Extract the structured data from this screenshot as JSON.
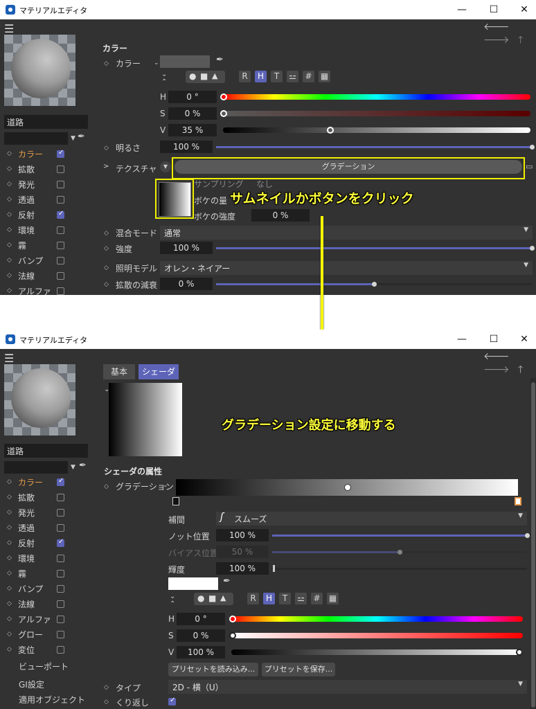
{
  "window_title": "マテリアルエディタ",
  "win_controls": {
    "minimize": "—",
    "maximize": "☐",
    "close": "✕"
  },
  "nav": {
    "back": "🡐",
    "forward": "🡒",
    "up": "🡑"
  },
  "material_name": "道路",
  "channels": [
    {
      "label": "カラー",
      "checked": true,
      "active": true
    },
    {
      "label": "拡散",
      "checked": false
    },
    {
      "label": "発光",
      "checked": false
    },
    {
      "label": "透過",
      "checked": false
    },
    {
      "label": "反射",
      "checked": true
    },
    {
      "label": "環境",
      "checked": false
    },
    {
      "label": "霧",
      "checked": false
    },
    {
      "label": "バンプ",
      "checked": false
    },
    {
      "label": "法線",
      "checked": false
    },
    {
      "label": "アルファ",
      "checked": false
    },
    {
      "label": "グロー",
      "checked": false
    },
    {
      "label": "変位",
      "checked": false
    }
  ],
  "sidebar_extra": [
    "ビューポート",
    "GI設定",
    "適用オブジェクト"
  ],
  "top": {
    "section": "カラー",
    "color_label": "カラー",
    "mode_buttons": [
      "R",
      "H",
      "T",
      "⚍",
      "#",
      "▦"
    ],
    "h_label": "H",
    "h_value": "0 °",
    "s_label": "S",
    "s_value": "0 %",
    "v_label": "V",
    "v_value": "35 %",
    "v_level": 0.35,
    "brightness_label": "明るさ",
    "brightness_value": "100 %",
    "brightness_level": 1.0,
    "texture_label": "テクスチャ",
    "texture_button": "グラデーション",
    "filter_label": "サンプリング",
    "filter_value": "なし",
    "blur_amount_label": "ボケの量",
    "blur_strength_label": "ボケの強度",
    "blur_strength_value": "0 %",
    "blend_mode_label": "混合モード",
    "blend_mode_value": "通常",
    "strength_label": "強度",
    "strength_value": "100 %",
    "strength_level": 1.0,
    "lighting_label": "照明モデル",
    "lighting_value": "オレン・ネイアー",
    "diffuse_falloff_label": "拡散の減衰",
    "diffuse_falloff_value": "0 %",
    "diffuse_falloff_level": 0.5
  },
  "bottom": {
    "tabs": [
      "基本",
      "シェーダ"
    ],
    "shader_props_title": "シェーダの属性",
    "gradient_label": "グラデーション",
    "interp_label": "補間",
    "interp_value": "スムーズ",
    "knot_pos_label": "ノット位置",
    "knot_pos_value": "100 %",
    "knot_pos_level": 1.0,
    "bias_pos_label": "バイアス位置",
    "bias_pos_value": "50 %",
    "bias_pos_level": 0.5,
    "brightness_label": "輝度",
    "brightness_value": "100 %",
    "brightness_level": 0.0,
    "mode_buttons": [
      "R",
      "H",
      "T",
      "⚍",
      "#",
      "▦"
    ],
    "h_label": "H",
    "h_value": "0 °",
    "s_label": "S",
    "s_value": "0 %",
    "v_label": "V",
    "v_value": "100 %",
    "load_preset": "プリセットを読み込み...",
    "save_preset": "プリセットを保存...",
    "type_label": "タイプ",
    "type_value": "2D - 横（U）",
    "repeat_label": "くり返し",
    "repeat_checked": true
  },
  "annotations": {
    "click_hint": "サムネイルかボタンをクリック",
    "move_hint": "グラデーション設定に移動する"
  },
  "colors": {
    "accent": "#5d64b8",
    "active_channel": "#e89c4b",
    "annotation": "#ffff3a",
    "bg": "#323232"
  }
}
